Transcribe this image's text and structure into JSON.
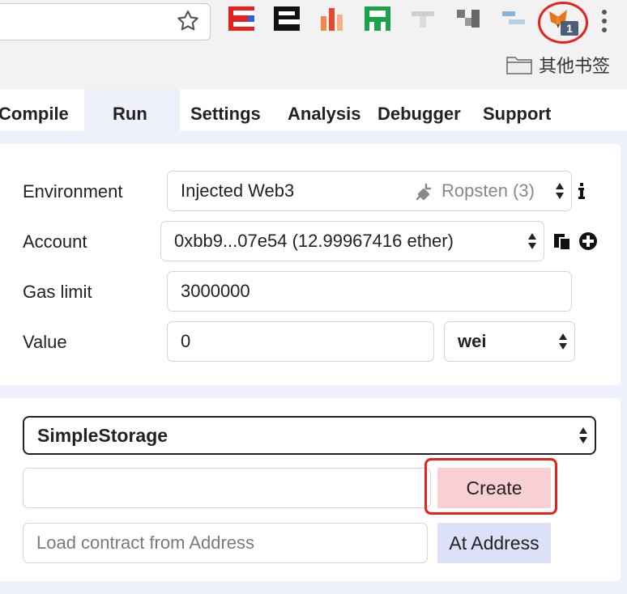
{
  "browser": {
    "bookmark_folder_label": "其他书签",
    "extension_badge_count": "1",
    "extension_icons": [
      "ext-icon-1",
      "ext-icon-2",
      "ext-icon-3",
      "ext-icon-4",
      "ext-icon-5",
      "ext-icon-6",
      "ext-icon-7",
      "metamask-fox-icon"
    ]
  },
  "tabs": [
    {
      "label": "Compile",
      "active": false
    },
    {
      "label": "Run",
      "active": true
    },
    {
      "label": "Settings",
      "active": false
    },
    {
      "label": "Analysis",
      "active": false
    },
    {
      "label": "Debugger",
      "active": false
    },
    {
      "label": "Support",
      "active": false
    }
  ],
  "settings": {
    "environment": {
      "label": "Environment",
      "value": "Injected Web3",
      "network": "Ropsten (3)"
    },
    "account": {
      "label": "Account",
      "value": "0xbb9...07e54 (12.99967416 ether)"
    },
    "gas_limit": {
      "label": "Gas limit",
      "value": "3000000"
    },
    "value": {
      "label": "Value",
      "amount": "0",
      "unit": "wei"
    }
  },
  "contract": {
    "selected": "SimpleStorage",
    "create_label": "Create",
    "create_args": "",
    "address_placeholder": "Load contract from Address",
    "at_address_label": "At Address"
  },
  "colors": {
    "highlight_ring": "#e3231c",
    "create_button": "#f8d0d4",
    "at_address_button": "#dce0f8",
    "panel_background": "#eef0fb"
  }
}
